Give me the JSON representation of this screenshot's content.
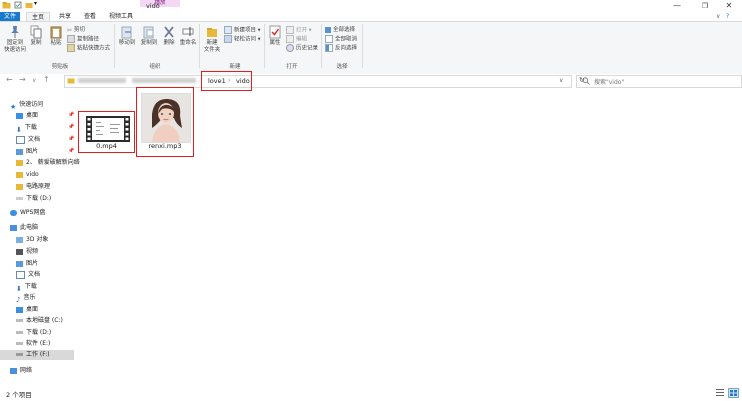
{
  "window": {
    "title": "vido",
    "context_tab": "播放",
    "controls": [
      "—",
      "❐",
      "✕"
    ]
  },
  "tabs": [
    "文件",
    "主页",
    "共享",
    "查看",
    "视频工具"
  ],
  "ribbon": {
    "clipboard": {
      "label": "剪贴板",
      "pin": "固定到快速访问",
      "pin_l1": "固定到",
      "pin_l2": "快速访问",
      "copy": "复制",
      "paste": "粘贴",
      "cut": "剪切",
      "copy_path": "复制路径",
      "paste_shortcut": "粘贴快捷方式"
    },
    "organize": {
      "label": "组织",
      "move_to": "移动到",
      "copy_to": "复制到",
      "delete": "删除",
      "rename": "重命名"
    },
    "new": {
      "label": "新建",
      "new_folder_l1": "新建",
      "new_folder_l2": "文件夹",
      "new_item": "新建项目 ▾",
      "easy_access": "轻松访问 ▾"
    },
    "open": {
      "label": "打开",
      "properties": "属性",
      "open": "打开 ▾",
      "edit": "编辑",
      "history": "历史记录"
    },
    "select": {
      "label": "选择",
      "select_all": "全部选择",
      "select_none": "全部取消",
      "invert": "反向选择"
    }
  },
  "address": {
    "back": "←",
    "forward": "→",
    "recent": "∨",
    "up": "↑",
    "crumbs": [
      "love1",
      "vido"
    ],
    "separator": "›",
    "refresh": "↻",
    "search_placeholder": "搜索\"vido\""
  },
  "sidebar": {
    "quick_access": "快速访问",
    "quick_items": [
      "桌面",
      "下载",
      "文档",
      "图片",
      "2、 薪爱破解新向络",
      "vido",
      "电路原理",
      "下载 (D:)"
    ],
    "wps": "WPS网盘",
    "this_pc": "此电脑",
    "pc_items": [
      "3D 对象",
      "视频",
      "图片",
      "文档",
      "下载",
      "音乐",
      "桌面",
      "本地磁盘 (C:)",
      "下载 (D:)",
      "软件 (E:)",
      "工作 (F:)"
    ],
    "network": "网络"
  },
  "files": [
    {
      "name": "0.mp4",
      "type": "video"
    },
    {
      "name": "renxi.mp3",
      "type": "audio-with-cover"
    }
  ],
  "status": {
    "count": "2 个项目"
  },
  "colors": {
    "accent": "#1979ca",
    "highlight_box": "#e02020",
    "context_tab": "#f4d7f4"
  }
}
